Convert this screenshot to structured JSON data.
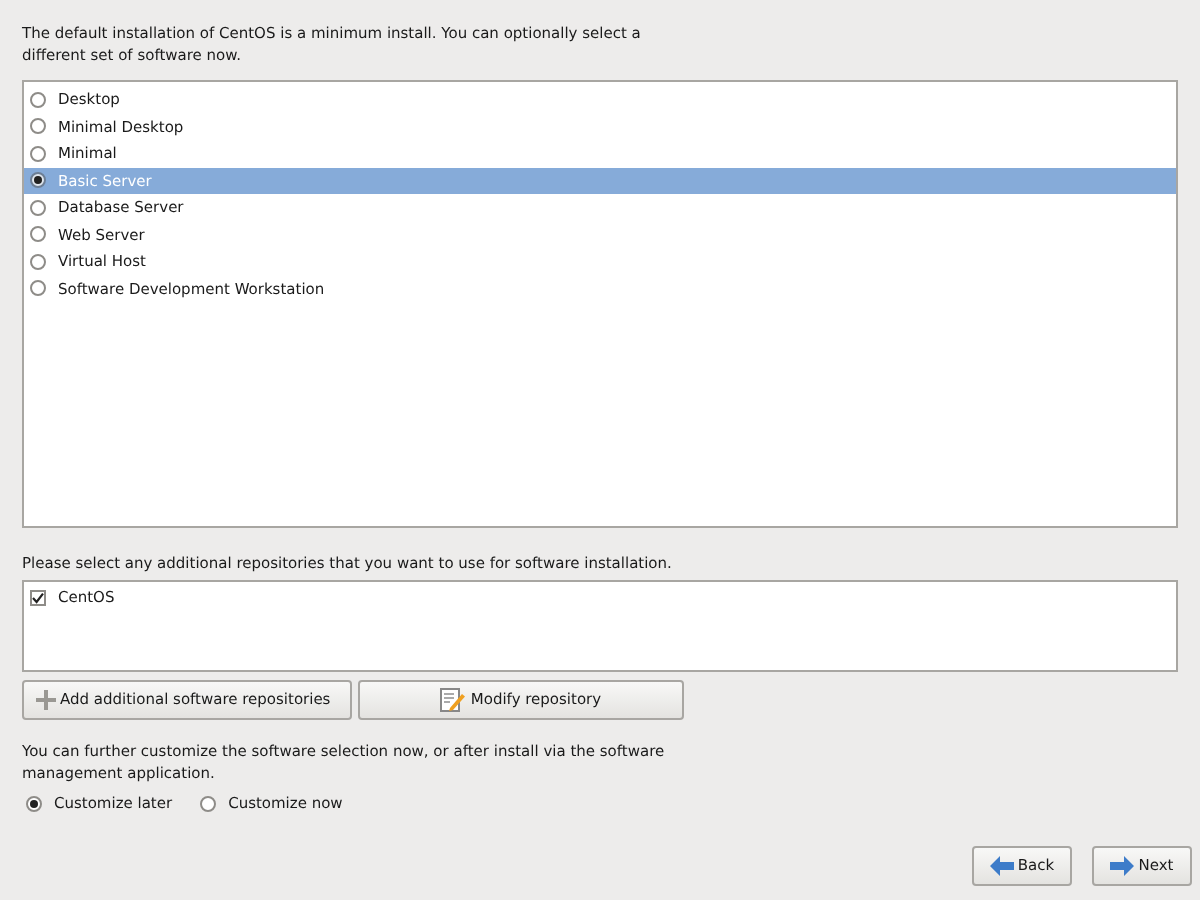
{
  "intro": "The default installation of CentOS is a minimum install. You can optionally select a different set of software now.",
  "software_sets": [
    {
      "label": "Desktop",
      "selected": false
    },
    {
      "label": "Minimal Desktop",
      "selected": false
    },
    {
      "label": "Minimal",
      "selected": false
    },
    {
      "label": "Basic Server",
      "selected": true
    },
    {
      "label": "Database Server",
      "selected": false
    },
    {
      "label": "Web Server",
      "selected": false
    },
    {
      "label": "Virtual Host",
      "selected": false
    },
    {
      "label": "Software Development Workstation",
      "selected": false
    }
  ],
  "repositories_label": "Please select any additional repositories that you want to use for software installation.",
  "repositories": [
    {
      "label": "CentOS",
      "checked": true
    }
  ],
  "repo_buttons": [
    {
      "label": "Add additional software repositories",
      "kind": "plus"
    },
    {
      "label": "Modify repository",
      "kind": "edit"
    }
  ],
  "customize_text": "You can further customize the software selection now, or after install via the software management application.",
  "customize_options": [
    {
      "label": "Customize later",
      "selected": true
    },
    {
      "label": "Customize now",
      "selected": false
    }
  ],
  "nav_buttons": [
    {
      "label": "Back",
      "kind": "back"
    },
    {
      "label": "Next",
      "kind": "next"
    }
  ]
}
